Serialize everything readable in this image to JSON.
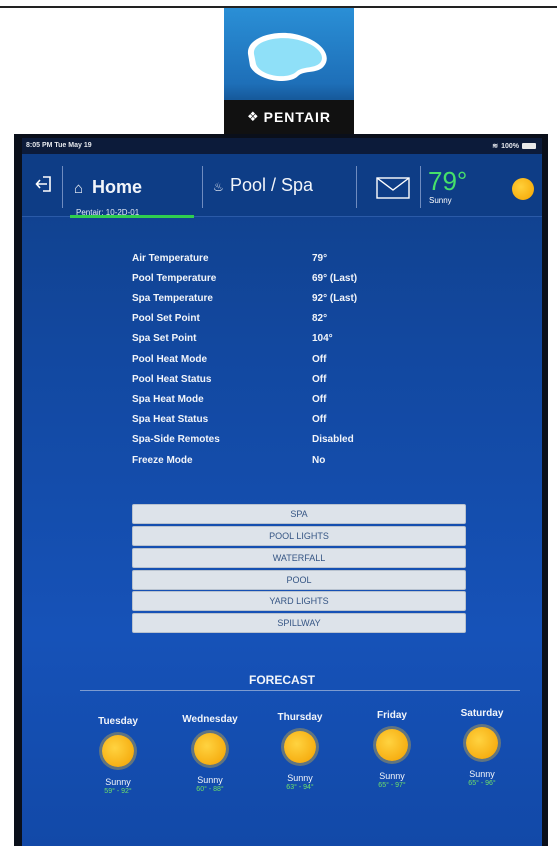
{
  "logo": {
    "brand": "PENTAIR"
  },
  "status_bar": {
    "time_date": "8:05 PM  Tue May 19",
    "battery": "100%"
  },
  "header": {
    "home_label": "Home",
    "site_label": "Pentair: 10-2D-01",
    "pool_spa_label": "Pool / Spa",
    "weather_temp": "79°",
    "weather_condition": "Sunny"
  },
  "status_info": [
    {
      "label": "Air Temperature",
      "value": "79°"
    },
    {
      "label": "Pool Temperature",
      "value": "69° (Last)"
    },
    {
      "label": "Spa Temperature",
      "value": "92° (Last)"
    },
    {
      "label": "Pool Set Point",
      "value": "82°"
    },
    {
      "label": "Spa Set Point",
      "value": "104°"
    },
    {
      "label": "Pool Heat Mode",
      "value": "Off"
    },
    {
      "label": "Pool Heat Status",
      "value": "Off"
    },
    {
      "label": "Spa Heat Mode",
      "value": "Off"
    },
    {
      "label": "Spa Heat Status",
      "value": "Off"
    },
    {
      "label": "Spa-Side Remotes",
      "value": "Disabled"
    },
    {
      "label": "Freeze Mode",
      "value": "No"
    }
  ],
  "controls": [
    "SPA",
    "POOL LIGHTS",
    "WATERFALL",
    "POOL",
    "YARD LIGHTS",
    "SPILLWAY"
  ],
  "forecast": {
    "title": "FORECAST",
    "days": [
      {
        "day": "Tuesday",
        "condition": "Sunny",
        "range": "59° - 92°"
      },
      {
        "day": "Wednesday",
        "condition": "Sunny",
        "range": "60° - 88°"
      },
      {
        "day": "Thursday",
        "condition": "Sunny",
        "range": "63° - 94°"
      },
      {
        "day": "Friday",
        "condition": "Sunny",
        "range": "65° - 97°"
      },
      {
        "day": "Saturday",
        "condition": "Sunny",
        "range": "65° - 96°"
      }
    ]
  },
  "colors": {
    "accent_green": "#46e06a",
    "screen_blue": "#1248a0",
    "sun": "#f4a300"
  },
  "icons": [
    "exit-icon",
    "home-icon",
    "spa-icon",
    "mail-icon",
    "sun-icon",
    "wifi-icon",
    "battery-icon"
  ]
}
